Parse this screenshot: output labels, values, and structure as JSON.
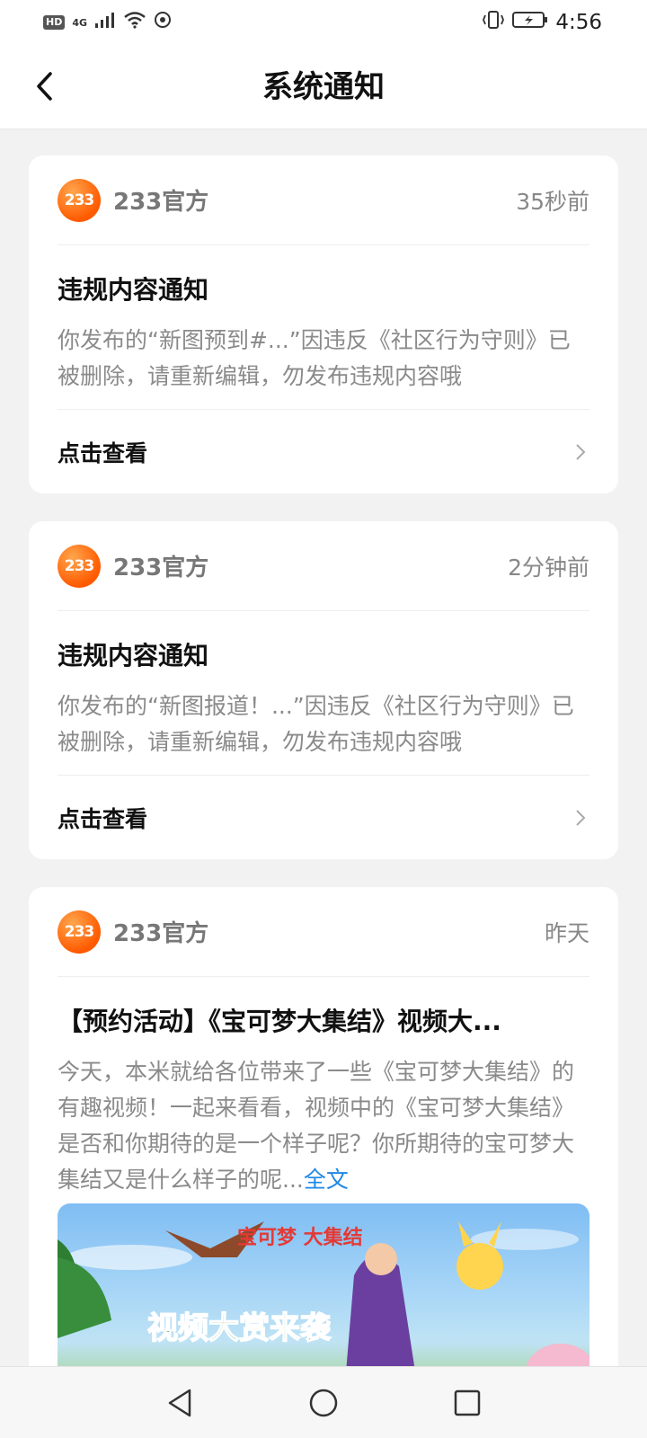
{
  "status_bar": {
    "hd": "HD",
    "network": "4G",
    "time": "4:56"
  },
  "header": {
    "title": "系统通知"
  },
  "notifications": [
    {
      "avatar_text": "233",
      "sender": "233官方",
      "time": "35秒前",
      "title": "违规内容通知",
      "body": "你发布的“新图预到#...”因违反《社区行为守则》已被删除，请重新编辑，勿发布违规内容哦",
      "action": "点击查看"
    },
    {
      "avatar_text": "233",
      "sender": "233官方",
      "time": "2分钟前",
      "title": "违规内容通知",
      "body": "你发布的“新图报道！...”因违反《社区行为守则》已被删除，请重新编辑，勿发布违规内容哦",
      "action": "点击查看"
    },
    {
      "avatar_text": "233",
      "sender": "233官方",
      "time": "昨天",
      "title": "【预约活动】《宝可梦大集结》视频大...",
      "body": "今天，本米就给各位带来了一些《宝可梦大集结》的有趣视频！一起来看看，视频中的《宝可梦大集结》是否和你期待的是一个样子呢？你所期待的宝可梦大集结又是什么样子的呢...",
      "more": "全文",
      "banner_logo": "宝可梦 大集结",
      "banner_text": "视频大赏来袭"
    }
  ],
  "colors": {
    "accent_orange": "#ff6a00",
    "link_blue": "#1e88e5",
    "background": "#f2f2f2"
  }
}
